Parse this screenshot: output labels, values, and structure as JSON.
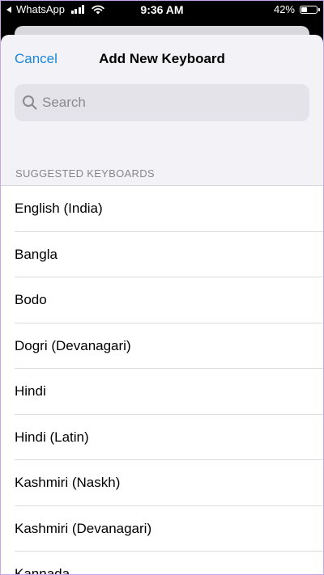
{
  "status_bar": {
    "back_app": "WhatsApp",
    "time": "9:36 AM",
    "battery_text": "42%",
    "battery_level": 0.42
  },
  "nav": {
    "cancel_label": "Cancel",
    "title": "Add New Keyboard"
  },
  "search": {
    "placeholder": "Search",
    "value": ""
  },
  "section": {
    "header": "SUGGESTED KEYBOARDS"
  },
  "keyboards": [
    "English (India)",
    "Bangla",
    "Bodo",
    "Dogri (Devanagari)",
    "Hindi",
    "Hindi (Latin)",
    "Kashmiri (Naskh)",
    "Kashmiri (Devanagari)",
    "Kannada"
  ],
  "colors": {
    "accent": "#1a86d6",
    "sheet_background": "#f2f2f7",
    "search_background": "#e3e3e9",
    "secondary_text": "#86868b"
  }
}
